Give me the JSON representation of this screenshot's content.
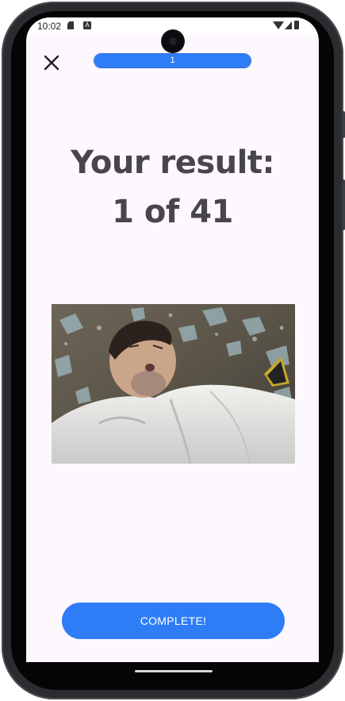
{
  "status_bar": {
    "time": "10:02",
    "icons": [
      "sd-card-icon",
      "keyboard-a-icon",
      "wifi-icon",
      "signal-icon",
      "battery-icon"
    ]
  },
  "header": {
    "close_icon": "close-icon",
    "progress": {
      "label": "1",
      "fraction": 1.0
    }
  },
  "result": {
    "title": "Your result:",
    "score": "1 of 41"
  },
  "image": {
    "alt": ""
  },
  "actions": {
    "complete_label": "COMPLETE!"
  },
  "colors": {
    "accent": "#2f7df6",
    "background": "#fdf7fe",
    "text": "#48464c"
  }
}
